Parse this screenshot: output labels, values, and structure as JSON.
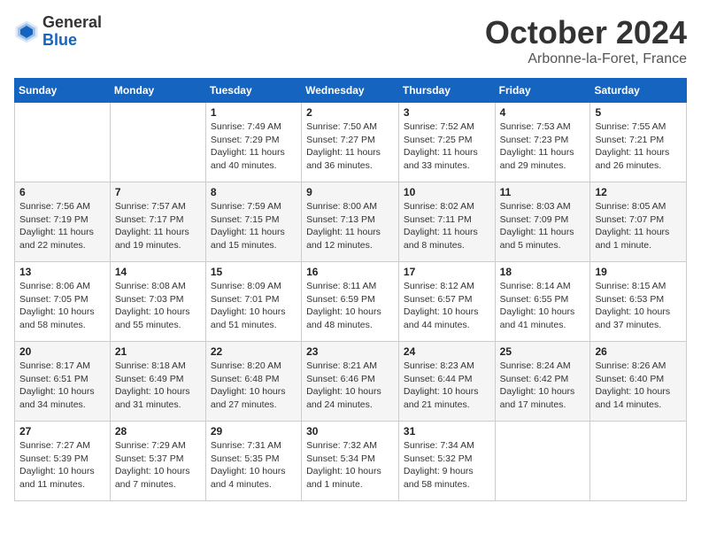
{
  "header": {
    "logo_general": "General",
    "logo_blue": "Blue",
    "month_title": "October 2024",
    "subtitle": "Arbonne-la-Foret, France"
  },
  "days_of_week": [
    "Sunday",
    "Monday",
    "Tuesday",
    "Wednesday",
    "Thursday",
    "Friday",
    "Saturday"
  ],
  "weeks": [
    [
      {
        "day": "",
        "info": ""
      },
      {
        "day": "",
        "info": ""
      },
      {
        "day": "1",
        "info": "Sunrise: 7:49 AM\nSunset: 7:29 PM\nDaylight: 11 hours\nand 40 minutes."
      },
      {
        "day": "2",
        "info": "Sunrise: 7:50 AM\nSunset: 7:27 PM\nDaylight: 11 hours\nand 36 minutes."
      },
      {
        "day": "3",
        "info": "Sunrise: 7:52 AM\nSunset: 7:25 PM\nDaylight: 11 hours\nand 33 minutes."
      },
      {
        "day": "4",
        "info": "Sunrise: 7:53 AM\nSunset: 7:23 PM\nDaylight: 11 hours\nand 29 minutes."
      },
      {
        "day": "5",
        "info": "Sunrise: 7:55 AM\nSunset: 7:21 PM\nDaylight: 11 hours\nand 26 minutes."
      }
    ],
    [
      {
        "day": "6",
        "info": "Sunrise: 7:56 AM\nSunset: 7:19 PM\nDaylight: 11 hours\nand 22 minutes."
      },
      {
        "day": "7",
        "info": "Sunrise: 7:57 AM\nSunset: 7:17 PM\nDaylight: 11 hours\nand 19 minutes."
      },
      {
        "day": "8",
        "info": "Sunrise: 7:59 AM\nSunset: 7:15 PM\nDaylight: 11 hours\nand 15 minutes."
      },
      {
        "day": "9",
        "info": "Sunrise: 8:00 AM\nSunset: 7:13 PM\nDaylight: 11 hours\nand 12 minutes."
      },
      {
        "day": "10",
        "info": "Sunrise: 8:02 AM\nSunset: 7:11 PM\nDaylight: 11 hours\nand 8 minutes."
      },
      {
        "day": "11",
        "info": "Sunrise: 8:03 AM\nSunset: 7:09 PM\nDaylight: 11 hours\nand 5 minutes."
      },
      {
        "day": "12",
        "info": "Sunrise: 8:05 AM\nSunset: 7:07 PM\nDaylight: 11 hours\nand 1 minute."
      }
    ],
    [
      {
        "day": "13",
        "info": "Sunrise: 8:06 AM\nSunset: 7:05 PM\nDaylight: 10 hours\nand 58 minutes."
      },
      {
        "day": "14",
        "info": "Sunrise: 8:08 AM\nSunset: 7:03 PM\nDaylight: 10 hours\nand 55 minutes."
      },
      {
        "day": "15",
        "info": "Sunrise: 8:09 AM\nSunset: 7:01 PM\nDaylight: 10 hours\nand 51 minutes."
      },
      {
        "day": "16",
        "info": "Sunrise: 8:11 AM\nSunset: 6:59 PM\nDaylight: 10 hours\nand 48 minutes."
      },
      {
        "day": "17",
        "info": "Sunrise: 8:12 AM\nSunset: 6:57 PM\nDaylight: 10 hours\nand 44 minutes."
      },
      {
        "day": "18",
        "info": "Sunrise: 8:14 AM\nSunset: 6:55 PM\nDaylight: 10 hours\nand 41 minutes."
      },
      {
        "day": "19",
        "info": "Sunrise: 8:15 AM\nSunset: 6:53 PM\nDaylight: 10 hours\nand 37 minutes."
      }
    ],
    [
      {
        "day": "20",
        "info": "Sunrise: 8:17 AM\nSunset: 6:51 PM\nDaylight: 10 hours\nand 34 minutes."
      },
      {
        "day": "21",
        "info": "Sunrise: 8:18 AM\nSunset: 6:49 PM\nDaylight: 10 hours\nand 31 minutes."
      },
      {
        "day": "22",
        "info": "Sunrise: 8:20 AM\nSunset: 6:48 PM\nDaylight: 10 hours\nand 27 minutes."
      },
      {
        "day": "23",
        "info": "Sunrise: 8:21 AM\nSunset: 6:46 PM\nDaylight: 10 hours\nand 24 minutes."
      },
      {
        "day": "24",
        "info": "Sunrise: 8:23 AM\nSunset: 6:44 PM\nDaylight: 10 hours\nand 21 minutes."
      },
      {
        "day": "25",
        "info": "Sunrise: 8:24 AM\nSunset: 6:42 PM\nDaylight: 10 hours\nand 17 minutes."
      },
      {
        "day": "26",
        "info": "Sunrise: 8:26 AM\nSunset: 6:40 PM\nDaylight: 10 hours\nand 14 minutes."
      }
    ],
    [
      {
        "day": "27",
        "info": "Sunrise: 7:27 AM\nSunset: 5:39 PM\nDaylight: 10 hours\nand 11 minutes."
      },
      {
        "day": "28",
        "info": "Sunrise: 7:29 AM\nSunset: 5:37 PM\nDaylight: 10 hours\nand 7 minutes."
      },
      {
        "day": "29",
        "info": "Sunrise: 7:31 AM\nSunset: 5:35 PM\nDaylight: 10 hours\nand 4 minutes."
      },
      {
        "day": "30",
        "info": "Sunrise: 7:32 AM\nSunset: 5:34 PM\nDaylight: 10 hours\nand 1 minute."
      },
      {
        "day": "31",
        "info": "Sunrise: 7:34 AM\nSunset: 5:32 PM\nDaylight: 9 hours\nand 58 minutes."
      },
      {
        "day": "",
        "info": ""
      },
      {
        "day": "",
        "info": ""
      }
    ]
  ]
}
